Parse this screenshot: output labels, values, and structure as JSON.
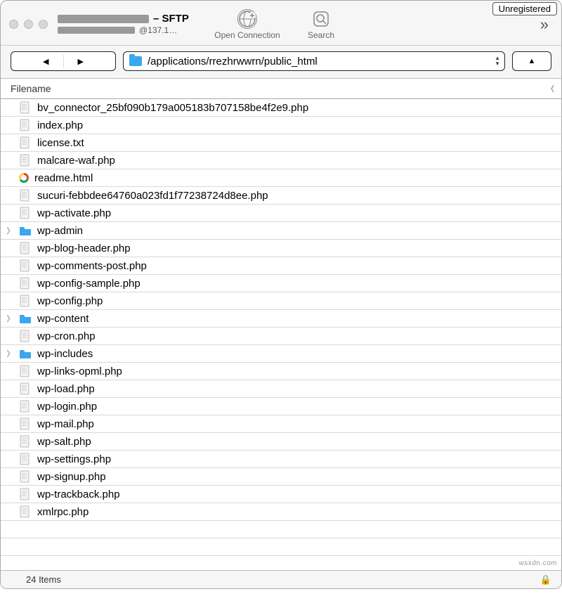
{
  "header": {
    "title_suffix": "– SFTP",
    "subtitle_suffix": "@137.1…",
    "open_connection_label": "Open Connection",
    "search_label": "Search",
    "unregistered_label": "Unregistered"
  },
  "pathbar": {
    "path": "/applications/rrezhrwwrn/public_html"
  },
  "columns": {
    "filename": "Filename"
  },
  "files": [
    {
      "name": "bv_connector_25bf090b179a005183b707158be4f2e9.php",
      "type": "file"
    },
    {
      "name": "index.php",
      "type": "file"
    },
    {
      "name": "license.txt",
      "type": "file"
    },
    {
      "name": "malcare-waf.php",
      "type": "file"
    },
    {
      "name": "readme.html",
      "type": "html"
    },
    {
      "name": "sucuri-febbdee64760a023fd1f77238724d8ee.php",
      "type": "file"
    },
    {
      "name": "wp-activate.php",
      "type": "file"
    },
    {
      "name": "wp-admin",
      "type": "folder"
    },
    {
      "name": "wp-blog-header.php",
      "type": "file"
    },
    {
      "name": "wp-comments-post.php",
      "type": "file"
    },
    {
      "name": "wp-config-sample.php",
      "type": "file"
    },
    {
      "name": "wp-config.php",
      "type": "file"
    },
    {
      "name": "wp-content",
      "type": "folder"
    },
    {
      "name": "wp-cron.php",
      "type": "file"
    },
    {
      "name": "wp-includes",
      "type": "folder"
    },
    {
      "name": "wp-links-opml.php",
      "type": "file"
    },
    {
      "name": "wp-load.php",
      "type": "file"
    },
    {
      "name": "wp-login.php",
      "type": "file"
    },
    {
      "name": "wp-mail.php",
      "type": "file"
    },
    {
      "name": "wp-salt.php",
      "type": "file"
    },
    {
      "name": "wp-settings.php",
      "type": "file"
    },
    {
      "name": "wp-signup.php",
      "type": "file"
    },
    {
      "name": "wp-trackback.php",
      "type": "file"
    },
    {
      "name": "xmlrpc.php",
      "type": "file"
    }
  ],
  "status": {
    "item_count_label": "24 Items"
  },
  "watermark": "wsxdn.com"
}
